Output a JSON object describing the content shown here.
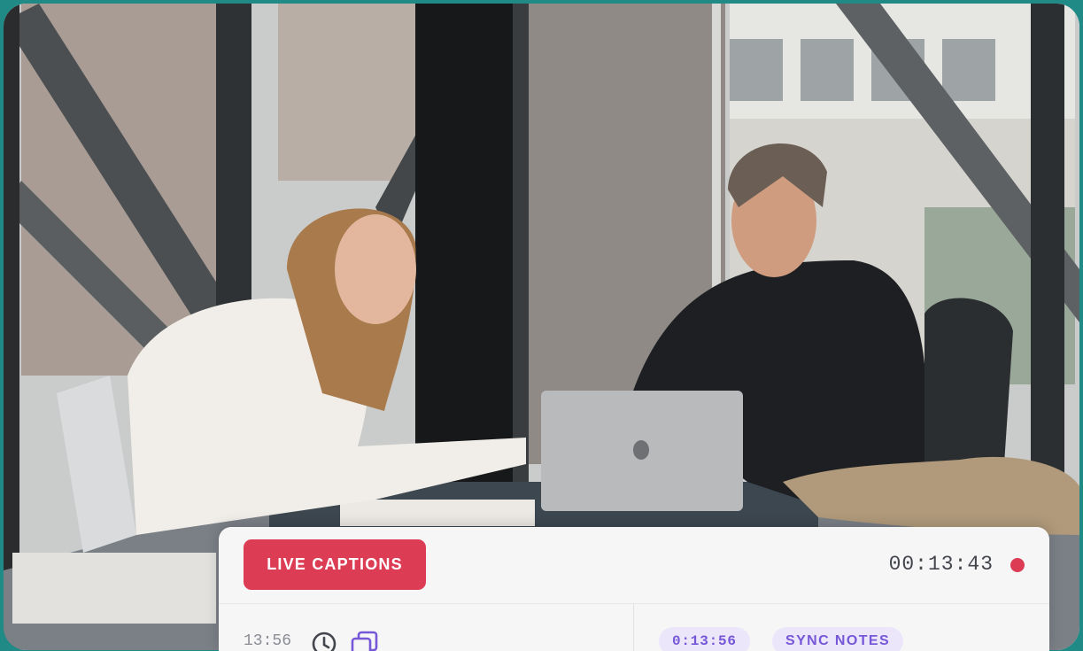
{
  "live_captions_label": "LIVE CAPTIONS",
  "timer": "00:13:43",
  "transcript_entry": {
    "time": "13:56"
  },
  "notes": {
    "time_chip": "0:13:56",
    "sync_label": "SYNC NOTES"
  },
  "colors": {
    "accent_red": "#dc3d54",
    "chip_bg": "#ece6fb",
    "chip_text": "#7657d7",
    "frame_teal": "#1f8a86"
  },
  "icons": [
    "clock-icon",
    "copy-icon",
    "record-dot-icon"
  ]
}
